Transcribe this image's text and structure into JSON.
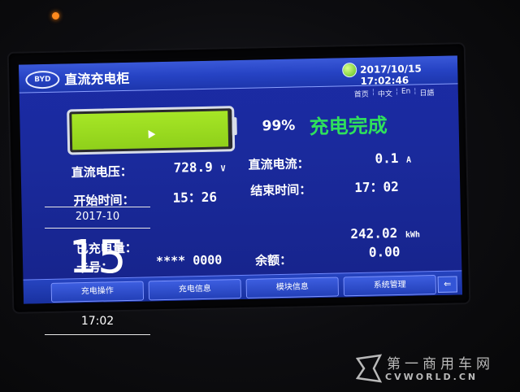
{
  "header": {
    "logo_text": "BYD",
    "title": "直流充电柜",
    "datetime": "2017/10/15 17:02:46",
    "languages": [
      "首页",
      "中文",
      "En",
      "日語"
    ]
  },
  "battery": {
    "level_percent": 99,
    "percent_text": "99%",
    "state_text": "充电完成"
  },
  "fields": {
    "dc_voltage_label": "直流电压：",
    "dc_voltage_value": "728.9",
    "dc_voltage_unit": "V",
    "dc_current_label": "直流电流：",
    "dc_current_value": "0.1",
    "dc_current_unit": "A",
    "start_time_label": "开始时间：",
    "start_time_value": "15：26",
    "end_time_label": "结束时间：",
    "end_time_value": "17：02",
    "charged_label": "已充电量：",
    "charged_value": "242.02",
    "charged_unit": "kWh",
    "card_label": "卡号：",
    "card_value": "**** 0000",
    "balance_label": "余额：",
    "balance_value": "0.00"
  },
  "bottom_tabs": [
    "充电操作",
    "充电信息",
    "模块信息",
    "系统管理"
  ],
  "back_symbol": "⇐",
  "overlay": {
    "date": "2017-10",
    "day": "15",
    "time": "17:02"
  },
  "watermark": {
    "cn": "第一商用车网",
    "en": "CVWORLD.CN"
  },
  "colors": {
    "screen_blue": "#1a2a9c",
    "battery_green": "#a6e626",
    "state_green": "#2fe05c",
    "led_orange": "#ff8a1e"
  }
}
